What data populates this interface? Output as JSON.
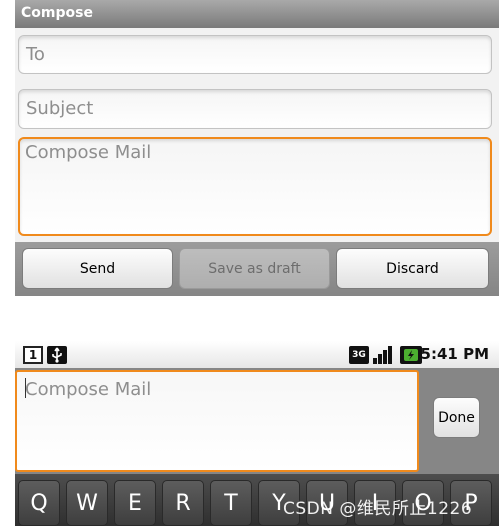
{
  "compose_screen": {
    "title": "Compose",
    "to_placeholder": "To",
    "subject_placeholder": "Subject",
    "body_placeholder": "Compose Mail",
    "buttons": {
      "send": "Send",
      "save_draft": "Save as draft",
      "discard": "Discard"
    }
  },
  "status_bar": {
    "notification_count": "1",
    "network_label": "3G",
    "time": "5:41 PM"
  },
  "ime_screen": {
    "body_placeholder": "Compose Mail",
    "done_label": "Done"
  },
  "keyboard": {
    "keys": [
      "Q",
      "W",
      "E",
      "R",
      "T",
      "Y",
      "U",
      "I",
      "O",
      "P"
    ]
  },
  "watermark": "CSDN @维民所止1226",
  "colors": {
    "focus_border": "#f08a1c",
    "bar_gray": "#868686"
  }
}
